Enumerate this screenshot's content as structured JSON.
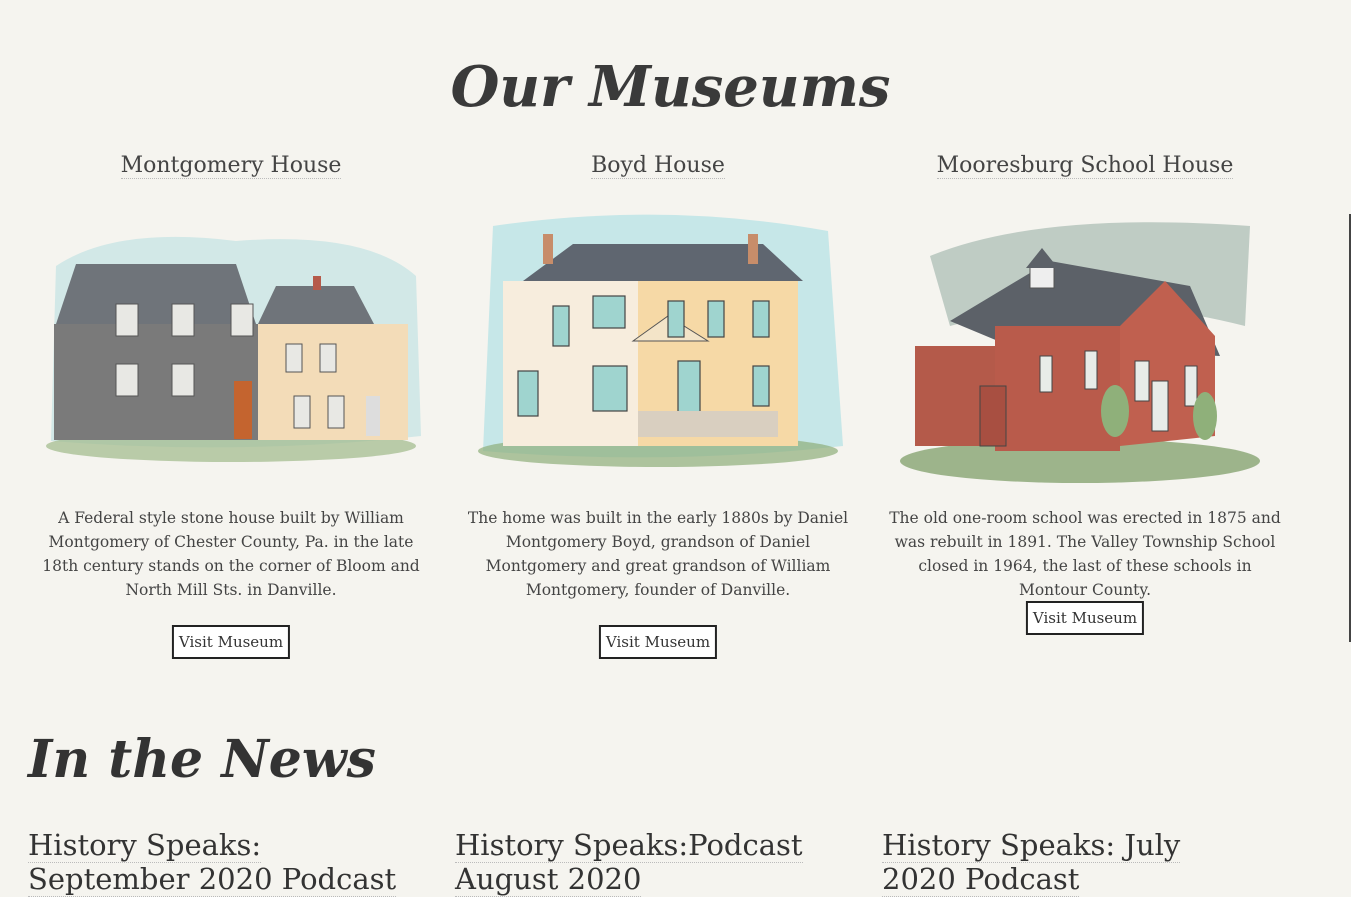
{
  "museums": {
    "title": "Our Museums",
    "items": [
      {
        "name": "Montgomery House",
        "description": "A Federal style stone house built by William Montgomery of Chester County, Pa. in the late 18th century stands on the corner of Bloom and North Mill Sts. in Danville.",
        "button": "Visit Museum"
      },
      {
        "name": "Boyd House",
        "description": "The home was built in the early 1880s by Daniel Montgomery Boyd, grandson of Daniel Montgomery and great grandson of William Montgomery, founder of Danville.",
        "button": "Visit Museum"
      },
      {
        "name": "Mooresburg School House",
        "description": "The old one-room school was erected in 1875 and was rebuilt in 1891. The Valley Township School closed in 1964, the last of these schools in Montour County.",
        "button": "Visit Museum"
      }
    ]
  },
  "news": {
    "title": "In the News",
    "items": [
      "History Speaks: September 2020 Podcast",
      "History Speaks:Podcast August 2020",
      "History Speaks: July 2020 Podcast"
    ]
  }
}
